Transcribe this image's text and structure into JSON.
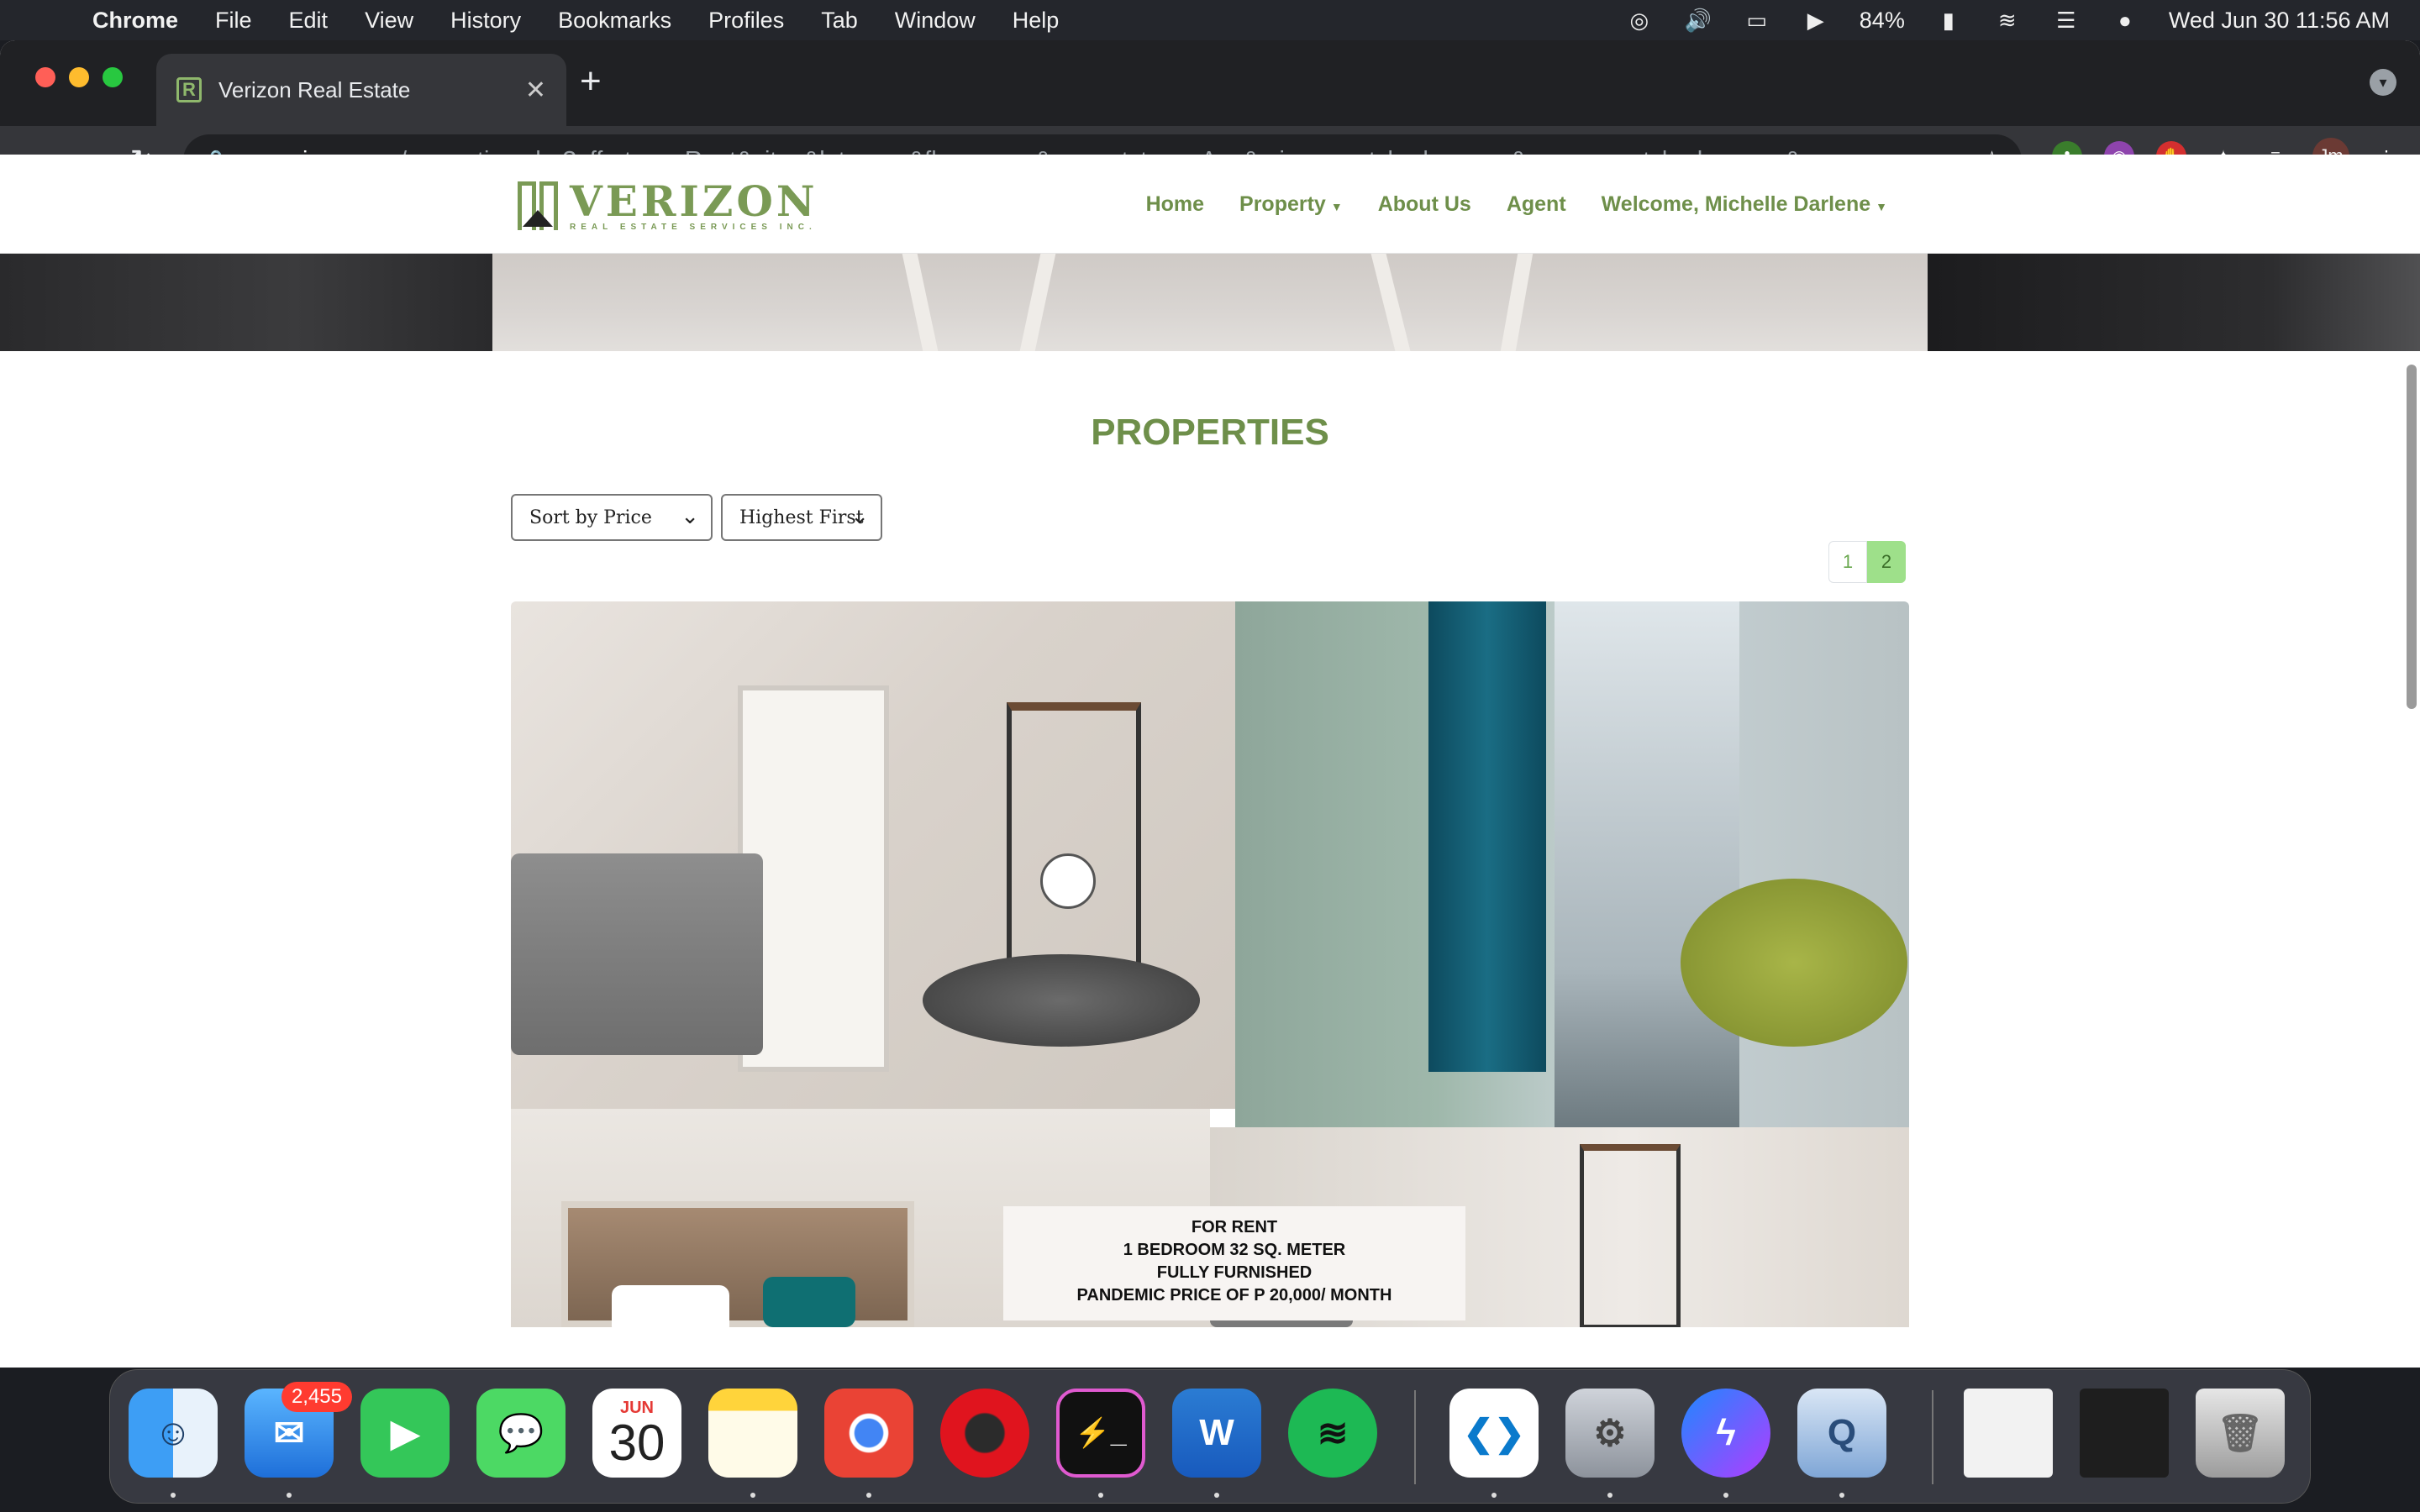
{
  "menubar": {
    "app": "Chrome",
    "items": [
      "File",
      "Edit",
      "View",
      "History",
      "Bookmarks",
      "Profiles",
      "Tab",
      "Window",
      "Help"
    ],
    "battery": "84%",
    "datetime": "Wed Jun 30  11:56 AM"
  },
  "browser": {
    "tab_title": "Verizon Real Estate",
    "url_host": "arverizon.com",
    "url_path": "/properties.php?offertype=Rent&city=&lotarea=&floorarea=&propertytype=Any&minpropertybedrooms=&maxpropertybedrooms=&pa...",
    "profile_initials": "Jm"
  },
  "site": {
    "logo_word": "VERIZON",
    "logo_sub": "REAL ESTATE SERVICES INC.",
    "nav": {
      "home": "Home",
      "property": "Property",
      "about": "About Us",
      "agent": "Agent",
      "welcome": "Welcome, Michelle Darlene"
    },
    "title": "PROPERTIES",
    "sort_by": "Sort by Price",
    "order": "Highest First",
    "pages": [
      "1",
      "2"
    ],
    "active_page": "2",
    "listing_overlay": {
      "line1": "FOR RENT",
      "line2": "1 BEDROOM 32 SQ. METER",
      "line3": "FULLY FURNISHED",
      "line4": "PANDEMIC PRICE OF P 20,000/ MONTH"
    }
  },
  "dock": {
    "mail_badge": "2,455",
    "calendar_month": "JUN",
    "calendar_day": "30"
  },
  "colors": {
    "brand_green": "#6e8f4a",
    "active_page": "#9ee08a"
  }
}
